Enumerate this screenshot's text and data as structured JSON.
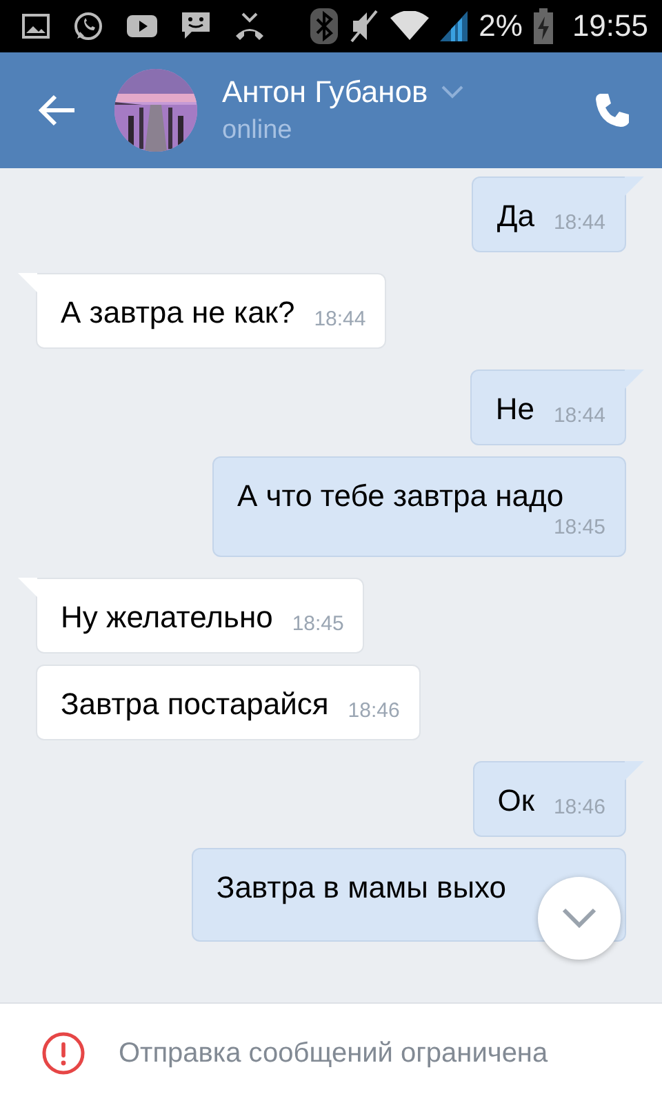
{
  "status_bar": {
    "battery": "2%",
    "time": "19:55"
  },
  "header": {
    "name": "Антон Губанов",
    "status": "online"
  },
  "messages": [
    {
      "kind": "outgoing",
      "text": "Да",
      "time": "18:44",
      "tail": true
    },
    {
      "kind": "incoming",
      "text": "А завтра не как?",
      "time": "18:44",
      "tail": true
    },
    {
      "kind": "outgoing",
      "text": "Не",
      "time": "18:44",
      "tail": true
    },
    {
      "kind": "outgoing",
      "text": "А что тебе завтра надо",
      "time": "18:45",
      "tail": false
    },
    {
      "kind": "incoming",
      "text": "Ну желательно",
      "time": "18:45",
      "tail": true
    },
    {
      "kind": "incoming",
      "text": "Завтра постарайся",
      "time": "18:46",
      "tail": false
    },
    {
      "kind": "outgoing",
      "text": "Ок",
      "time": "18:46",
      "tail": true
    },
    {
      "kind": "outgoing",
      "text": "Завтра в мамы выхо",
      "tail": false
    }
  ],
  "notice": {
    "text": "Отправка сообщений ограничена"
  }
}
